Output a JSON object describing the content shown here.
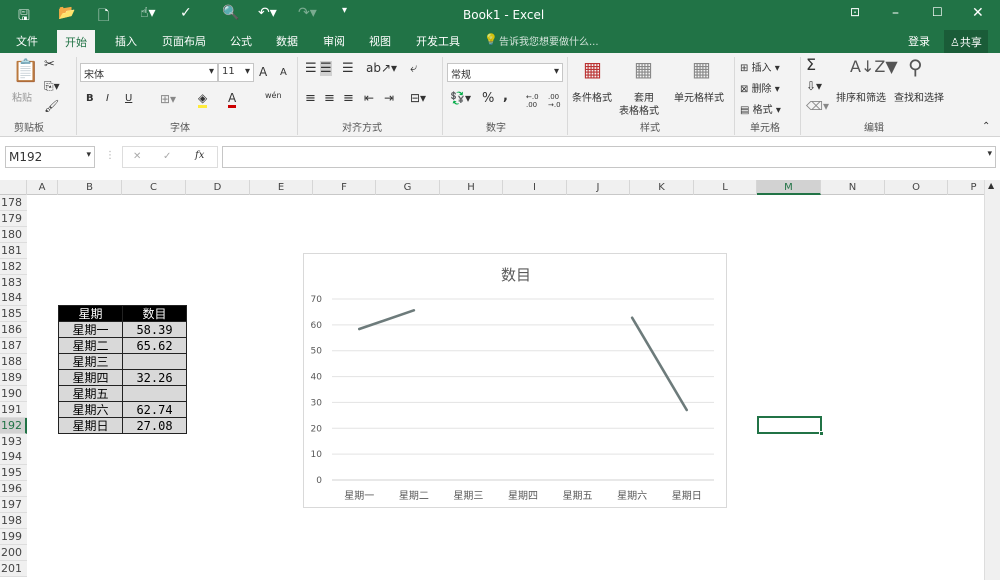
{
  "titlebar": {
    "title": "Book1 - Excel"
  },
  "tabs": [
    "文件",
    "开始",
    "插入",
    "页面布局",
    "公式",
    "数据",
    "审阅",
    "视图",
    "开发工具"
  ],
  "tell_me": "告诉我您想要做什么...",
  "login": "登录",
  "share": "共享",
  "ribbon": {
    "clipboard": {
      "paste": "粘贴",
      "group": "剪贴板"
    },
    "font": {
      "name": "宋体",
      "size": "11",
      "bold": "B",
      "italic": "I",
      "underline": "U",
      "group": "字体",
      "grow": "A",
      "shrink": "A",
      "font_color": "A",
      "phonetic": "wén"
    },
    "alignment": {
      "group": "对齐方式"
    },
    "number": {
      "format": "常规",
      "percent": "%",
      "comma": ",",
      "inc_dec": "←.0 .00",
      "dec_dec": ".00 →.0",
      "group": "数字"
    },
    "styles": {
      "cond": "条件格式",
      "table1": "套用",
      "table2": "表格格式",
      "cell": "单元格样式",
      "group": "样式"
    },
    "cells": {
      "insert": "插入",
      "delete": "删除",
      "format": "格式",
      "group": "单元格"
    },
    "editing": {
      "sum": "Σ",
      "sort": "排序和筛选",
      "find": "查找和选择",
      "group": "编辑"
    }
  },
  "formula_bar": {
    "name_box": "M192",
    "cancel": "✕",
    "enter": "✓",
    "fx": "fx",
    "value": ""
  },
  "columns": [
    "A",
    "B",
    "C",
    "D",
    "E",
    "F",
    "G",
    "H",
    "I",
    "J",
    "K",
    "L",
    "M",
    "N",
    "O",
    "P"
  ],
  "rows": [
    "178",
    "179",
    "180",
    "181",
    "182",
    "183",
    "184",
    "185",
    "186",
    "187",
    "188",
    "189",
    "190",
    "191",
    "192",
    "193",
    "194",
    "195",
    "196",
    "197",
    "198",
    "199",
    "200",
    "201"
  ],
  "table": {
    "headers": [
      "星期",
      "数目"
    ],
    "rows": [
      [
        "星期一",
        "58.39"
      ],
      [
        "星期二",
        "65.62"
      ],
      [
        "星期三",
        ""
      ],
      [
        "星期四",
        "32.26"
      ],
      [
        "星期五",
        ""
      ],
      [
        "星期六",
        "62.74"
      ],
      [
        "星期日",
        "27.08"
      ]
    ]
  },
  "chart_data": {
    "type": "line",
    "title": "数目",
    "categories": [
      "星期一",
      "星期二",
      "星期三",
      "星期四",
      "星期五",
      "星期六",
      "星期日"
    ],
    "series": [
      {
        "name": "数目",
        "values": [
          58.39,
          65.62,
          null,
          32.26,
          null,
          62.74,
          27.08
        ],
        "color": "#6d7b7b"
      }
    ],
    "ylim": [
      0,
      70
    ],
    "yticks": [
      0,
      10,
      20,
      30,
      40,
      50,
      60,
      70
    ],
    "grid": true,
    "legend": "none"
  }
}
